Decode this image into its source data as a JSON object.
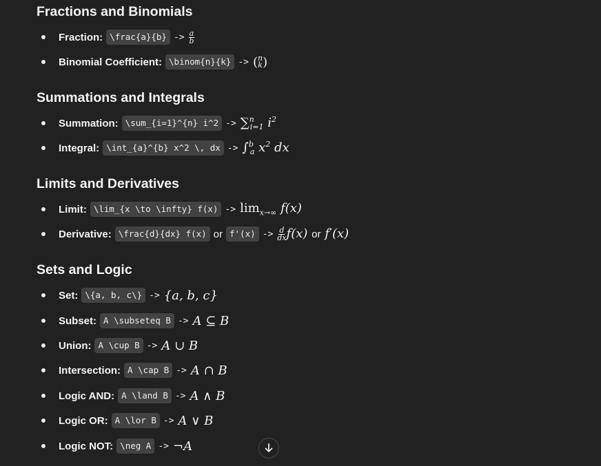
{
  "sections": [
    {
      "title": "Fractions and Binomials",
      "items": [
        {
          "label": "Fraction:",
          "code": "\\frac{a}{b}",
          "arrow": "->"
        },
        {
          "label": "Binomial Coefficient:",
          "code": "\\binom{n}{k}",
          "arrow": "->"
        }
      ]
    },
    {
      "title": "Summations and Integrals",
      "items": [
        {
          "label": "Summation:",
          "code": "\\sum_{i=1}^{n} i^2",
          "arrow": "->"
        },
        {
          "label": "Integral:",
          "code": "\\int_{a}^{b} x^2 \\, dx",
          "arrow": "->"
        }
      ]
    },
    {
      "title": "Limits and Derivatives",
      "items": [
        {
          "label": "Limit:",
          "code": "\\lim_{x \\to \\infty} f(x)",
          "arrow": "->"
        },
        {
          "label": "Derivative:",
          "code": "\\frac{d}{dx} f(x)",
          "conj": "or",
          "code2": "f'(x)",
          "arrow": "->",
          "math_or": "or"
        }
      ]
    },
    {
      "title": "Sets and Logic",
      "items": [
        {
          "label": "Set:",
          "code": "\\{a, b, c\\}",
          "arrow": "->",
          "math": "{a, b, c}"
        },
        {
          "label": "Subset:",
          "code": "A \\subseteq B",
          "arrow": "->",
          "math": "A ⊆ B"
        },
        {
          "label": "Union:",
          "code": "A \\cup B",
          "arrow": "->",
          "math": "A ∪ B"
        },
        {
          "label": "Intersection:",
          "code": "A \\cap B",
          "arrow": "->",
          "math": "A ∩ B"
        },
        {
          "label": "Logic AND:",
          "code": "A \\land B",
          "arrow": "->",
          "math": "A ∧ B"
        },
        {
          "label": "Logic OR:",
          "code": "A \\lor B",
          "arrow": "->",
          "math": "A ∨ B"
        },
        {
          "label": "Logic NOT:",
          "code": "\\neg A",
          "arrow": "->",
          "math": "¬A"
        }
      ]
    }
  ],
  "scroll_button": {
    "icon": "arrow-down-icon",
    "glyph": "↓"
  }
}
